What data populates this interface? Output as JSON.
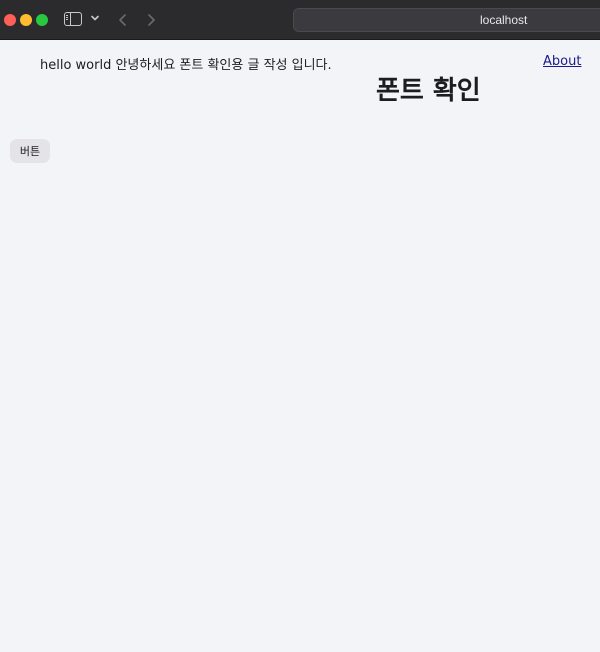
{
  "browser": {
    "url": "localhost",
    "icons": [
      "close-dot",
      "minimize-dot",
      "zoom-dot",
      "sidebar-toggle-icon",
      "chevron-down-icon",
      "back-arrow-icon",
      "forward-arrow-icon"
    ]
  },
  "page": {
    "intro_text": "hello world 안녕하세요 폰트 확인용 글 작성 입니다.",
    "about_link": "About",
    "title": "폰트 확인",
    "button_label": "버튼"
  },
  "colors": {
    "chrome_bg": "#2b2a2d",
    "page_bg": "#f3f4f8",
    "link": "#1a1a8c",
    "button_bg": "#e4e4e8",
    "traffic_red": "#fe5f57",
    "traffic_yellow": "#febc2e",
    "traffic_green": "#28c840"
  }
}
